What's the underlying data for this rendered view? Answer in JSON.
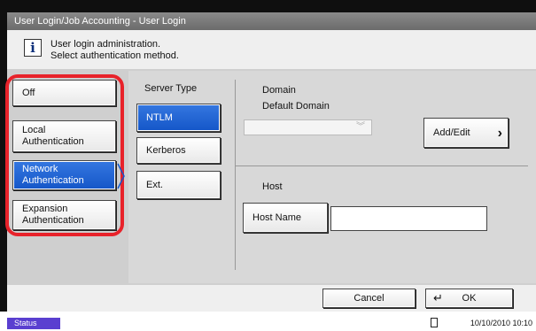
{
  "window": {
    "title": "User Login/Job Accounting - User Login"
  },
  "message": {
    "icon": "info-icon",
    "line1": "User login administration.",
    "line2": "Select authentication method."
  },
  "auth_methods": [
    {
      "label": "Off",
      "selected": false
    },
    {
      "label": "Local\nAuthentication",
      "selected": false
    },
    {
      "label": "Network\nAuthentication",
      "selected": true
    },
    {
      "label": "Expansion\nAuthentication",
      "selected": false
    }
  ],
  "server_type": {
    "label": "Server Type",
    "options": [
      {
        "label": "NTLM",
        "selected": true
      },
      {
        "label": "Kerberos",
        "selected": false
      },
      {
        "label": "Ext.",
        "selected": false
      }
    ]
  },
  "domain": {
    "label": "Domain",
    "default_label": "Default Domain",
    "dropdown_value": "",
    "add_edit_label": "Add/Edit"
  },
  "host": {
    "label": "Host",
    "host_name_label": "Host Name",
    "host_name_value": ""
  },
  "footer": {
    "cancel_label": "Cancel",
    "ok_label": "OK"
  },
  "status_bar": {
    "status_label": "Status",
    "datetime": "10/10/2010 10:10"
  },
  "colors": {
    "selected": "#1456c8",
    "highlight": "#e8222a",
    "status": "#5a3fd0"
  }
}
